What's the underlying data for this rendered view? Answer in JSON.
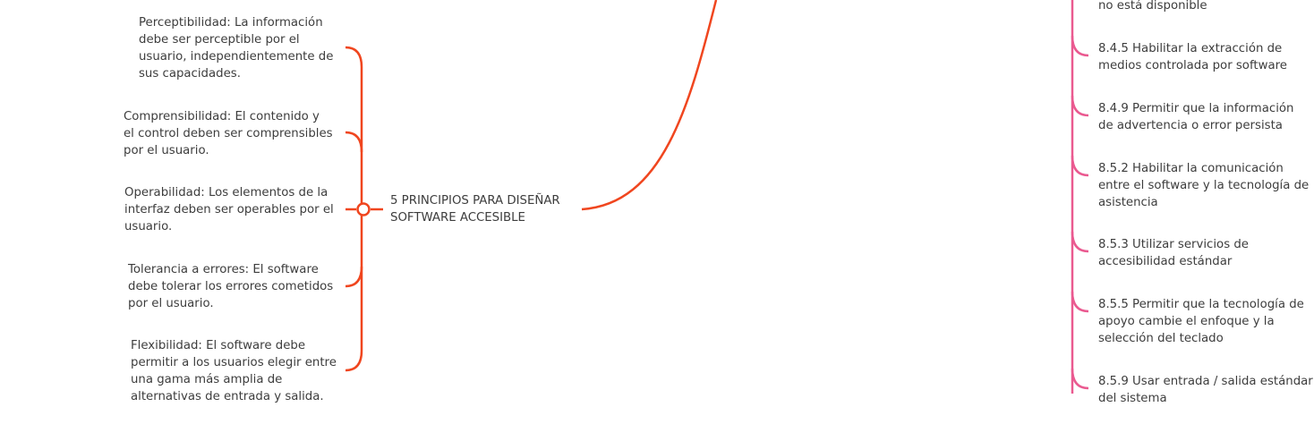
{
  "colors": {
    "left_branch": "#f0461f",
    "right_branch": "#ea5a90",
    "text": "#3d3d3d"
  },
  "center": {
    "lines": [
      "5 PRINCIPIOS PARA DISEÑAR",
      "SOFTWARE ACCESIBLE"
    ]
  },
  "principles": [
    {
      "lines": [
        "Perceptibilidad: La información",
        "debe ser perceptible por el",
        "usuario, independientemente de",
        "sus capacidades."
      ]
    },
    {
      "lines": [
        "Comprensibilidad: El contenido y",
        "el control deben ser comprensibles",
        "por el usuario."
      ]
    },
    {
      "lines": [
        "Operabilidad: Los elementos de la",
        "interfaz deben ser operables por el",
        "usuario."
      ]
    },
    {
      "lines": [
        "Tolerancia a errores: El software",
        "debe tolerar los errores cometidos",
        "por el usuario."
      ]
    },
    {
      "lines": [
        "Flexibilidad: El software debe",
        "permitir a los usuarios elegir entre",
        "una gama más amplia de",
        "alternativas de entrada y salida."
      ]
    }
  ],
  "guidelines": [
    {
      "lines": [
        "no está disponible"
      ]
    },
    {
      "lines": [
        "8.4.5 Habilitar la extracción de",
        "medios controlada por software"
      ]
    },
    {
      "lines": [
        "8.4.9 Permitir que la información",
        "de advertencia o error persista"
      ]
    },
    {
      "lines": [
        "8.5.2 Habilitar la comunicación",
        "entre el software y la tecnología de",
        "asistencia"
      ]
    },
    {
      "lines": [
        "8.5.3 Utilizar servicios de",
        "accesibilidad estándar"
      ]
    },
    {
      "lines": [
        "8.5.5 Permitir que la tecnología de",
        "apoyo cambie el enfoque y la",
        "selección del teclado"
      ]
    },
    {
      "lines": [
        "8.5.9 Usar entrada / salida estándar",
        "del sistema"
      ]
    }
  ]
}
